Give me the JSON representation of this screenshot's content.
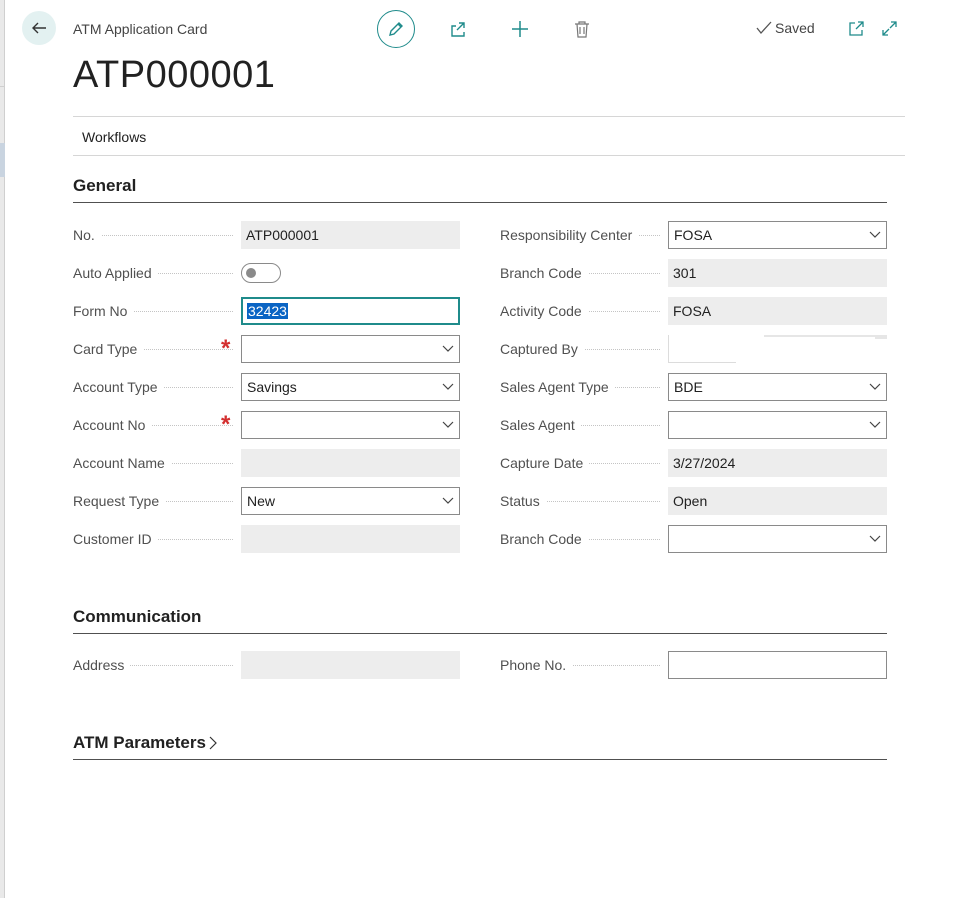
{
  "page": {
    "caption": "ATM Application Card",
    "record_title": "ATP000001",
    "status_saved": "Saved"
  },
  "toolbar": {
    "icons": [
      "back-arrow-icon",
      "pencil-icon",
      "share-icon",
      "plus-icon",
      "trash-icon",
      "checkmark-icon",
      "open-new-window-icon",
      "expand-icon"
    ],
    "accent_color": "#1f8b8b"
  },
  "actions": {
    "workflows": "Workflows"
  },
  "general": {
    "heading": "General",
    "left": {
      "no": {
        "label": "No.",
        "value": "ATP000001"
      },
      "auto_applied": {
        "label": "Auto Applied",
        "value": false
      },
      "form_no": {
        "label": "Form No",
        "value": "32423"
      },
      "card_type": {
        "label": "Card Type",
        "value": ""
      },
      "account_type": {
        "label": "Account Type",
        "value": "Savings"
      },
      "account_no": {
        "label": "Account No",
        "value": ""
      },
      "account_name": {
        "label": "Account Name",
        "value": ""
      },
      "request_type": {
        "label": "Request Type",
        "value": "New"
      },
      "customer_id": {
        "label": "Customer ID",
        "value": ""
      }
    },
    "right": {
      "responsibility_center": {
        "label": "Responsibility Center",
        "value": "FOSA"
      },
      "branch_code": {
        "label": "Branch Code",
        "value": "301"
      },
      "activity_code": {
        "label": "Activity Code",
        "value": "FOSA"
      },
      "captured_by": {
        "label": "Captured By",
        "value": ""
      },
      "sales_agent_type": {
        "label": "Sales Agent Type",
        "value": "BDE"
      },
      "sales_agent": {
        "label": "Sales Agent",
        "value": ""
      },
      "capture_date": {
        "label": "Capture Date",
        "value": "3/27/2024"
      },
      "status": {
        "label": "Status",
        "value": "Open"
      },
      "branch_code_2": {
        "label": "Branch Code",
        "value": ""
      }
    }
  },
  "communication": {
    "heading": "Communication",
    "address": {
      "label": "Address",
      "value": ""
    },
    "phone_no": {
      "label": "Phone No.",
      "value": ""
    }
  },
  "atm_parameters": {
    "heading": "ATM Parameters"
  },
  "colors": {
    "required": "#d32f2f",
    "selection": "#0a64c4",
    "readonly_bg": "#ededed"
  }
}
